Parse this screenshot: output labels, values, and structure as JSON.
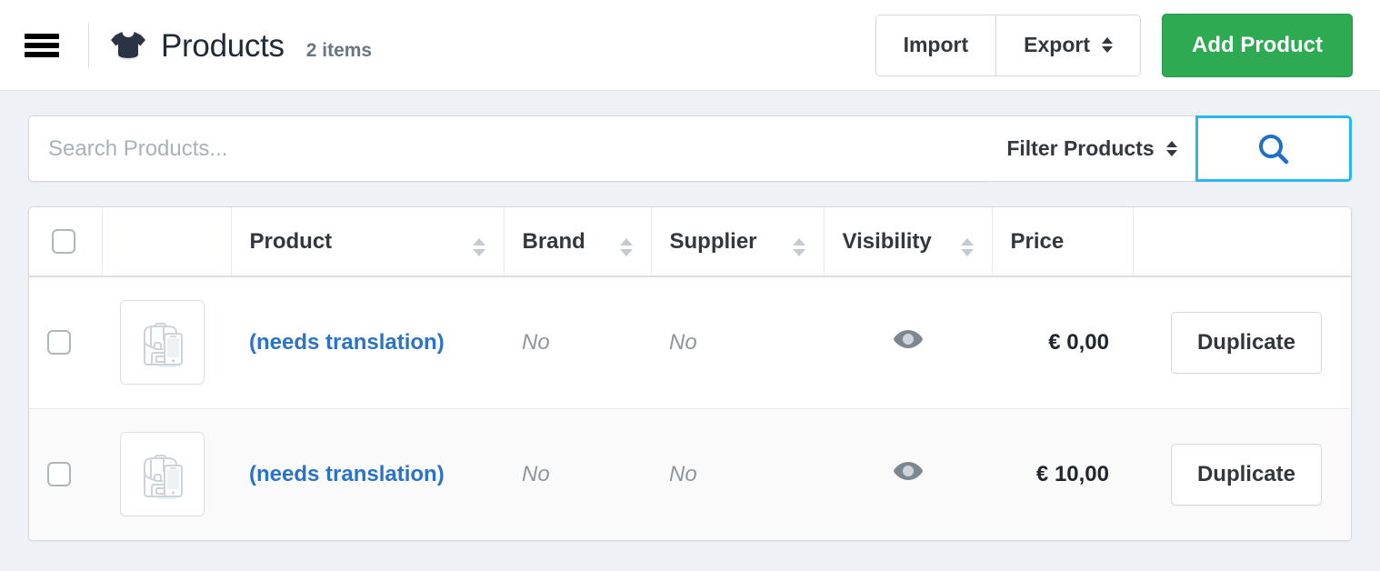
{
  "topbar": {
    "menu_icon": "hamburger-icon",
    "brand_icon": "tshirt-icon",
    "title": "Products",
    "item_count": "2 items",
    "import_label": "Import",
    "export_label": "Export",
    "add_product_label": "Add Product"
  },
  "search": {
    "placeholder": "Search Products...",
    "value": "",
    "filter_label": "Filter Products",
    "search_icon": "search-icon",
    "focus_color": "#29b6f5"
  },
  "table": {
    "columns": [
      {
        "key": "check",
        "label": "",
        "sortable": false
      },
      {
        "key": "thumb",
        "label": "",
        "sortable": false
      },
      {
        "key": "product",
        "label": "Product",
        "sortable": true
      },
      {
        "key": "brand",
        "label": "Brand",
        "sortable": true
      },
      {
        "key": "supplier",
        "label": "Supplier",
        "sortable": true
      },
      {
        "key": "visibility",
        "label": "Visibility",
        "sortable": true
      },
      {
        "key": "price",
        "label": "Price",
        "sortable": false
      },
      {
        "key": "actions",
        "label": "",
        "sortable": false
      }
    ],
    "rows": [
      {
        "selected": false,
        "thumbnail_icon": "product-placeholder-icon",
        "product": "(needs translation)",
        "brand": "No",
        "supplier": "No",
        "visibility_icon": "eye-icon",
        "price": "€ 0,00",
        "action_label": "Duplicate"
      },
      {
        "selected": false,
        "thumbnail_icon": "product-placeholder-icon",
        "product": "(needs translation)",
        "brand": "No",
        "supplier": "No",
        "visibility_icon": "eye-icon",
        "price": "€ 10,00",
        "action_label": "Duplicate"
      }
    ]
  },
  "colors": {
    "page_background": "#eef1f5",
    "primary_button": "#2eaa53",
    "link": "#2a73c5",
    "search_focus": "#29b6f5",
    "title_text": "#212b36"
  }
}
